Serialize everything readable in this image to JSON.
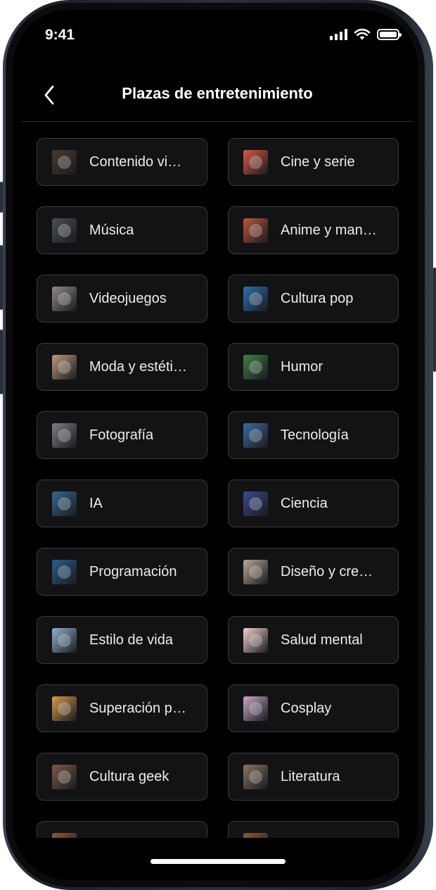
{
  "status_bar": {
    "time": "9:41"
  },
  "header": {
    "title": "Plazas de entretenimiento"
  },
  "categories": [
    {
      "label": "Contenido vi…",
      "thumb_color": "#4a3a30",
      "icon": "video-content-thumbnail"
    },
    {
      "label": "Cine y serie",
      "thumb_color": "#d9584a",
      "icon": "popcorn-thumbnail"
    },
    {
      "label": "Música",
      "thumb_color": "#4b4f57",
      "icon": "cassette-thumbnail"
    },
    {
      "label": "Anime y man…",
      "thumb_color": "#b9563a",
      "icon": "anime-sunset-thumbnail"
    },
    {
      "label": "Videojuegos",
      "thumb_color": "#8f8a86",
      "icon": "gamepad-thumbnail"
    },
    {
      "label": "Cultura pop",
      "thumb_color": "#2e6fae",
      "icon": "pop-culture-thumbnail"
    },
    {
      "label": "Moda y estéti…",
      "thumb_color": "#c09a7a",
      "icon": "fashion-thumbnail"
    },
    {
      "label": "Humor",
      "thumb_color": "#3f7f45",
      "icon": "frog-meme-thumbnail"
    },
    {
      "label": "Fotografía",
      "thumb_color": "#7e7f84",
      "icon": "camera-thumbnail"
    },
    {
      "label": "Tecnología",
      "thumb_color": "#3d6aa0",
      "icon": "technology-thumbnail"
    },
    {
      "label": "IA",
      "thumb_color": "#35688f",
      "icon": "robot-thumbnail"
    },
    {
      "label": "Ciencia",
      "thumb_color": "#3a4b8f",
      "icon": "brain-network-thumbnail"
    },
    {
      "label": "Programación",
      "thumb_color": "#2b5d8f",
      "icon": "code-thumbnail"
    },
    {
      "label": "Diseño y cre…",
      "thumb_color": "#b9a895",
      "icon": "design-desk-thumbnail"
    },
    {
      "label": "Estilo de vida",
      "thumb_color": "#8fb2d0",
      "icon": "lifestyle-thumbnail"
    },
    {
      "label": "Salud mental",
      "thumb_color": "#f2d2cc",
      "icon": "brain-thumbnail"
    },
    {
      "label": "Superación p…",
      "thumb_color": "#d69a4f",
      "icon": "sunrise-thumbnail"
    },
    {
      "label": "Cosplay",
      "thumb_color": "#c8a6c4",
      "icon": "cosplay-thumbnail"
    },
    {
      "label": "Cultura geek",
      "thumb_color": "#7d5a46",
      "icon": "geek-collage-thumbnail"
    },
    {
      "label": "Literatura",
      "thumb_color": "#8a7460",
      "icon": "books-thumbnail"
    },
    {
      "label": "",
      "thumb_color": "#8a5a3a",
      "icon": "category-thumbnail"
    },
    {
      "label": "",
      "thumb_color": "#8a5a3a",
      "icon": "category-thumbnail"
    }
  ]
}
